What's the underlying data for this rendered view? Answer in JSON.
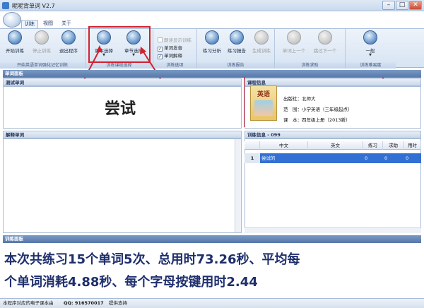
{
  "window": {
    "title": "呢呢背单词 V2.7",
    "min": "–",
    "max": "□",
    "close": "✕"
  },
  "tabs": [
    "训练",
    "视图",
    "关于"
  ],
  "ribbon": {
    "group1": {
      "caption": "开始英语单词强化记忆训练",
      "btn_start": "开始训练",
      "btn_stop": "停止训练",
      "btn_exit": "退出程序"
    },
    "group2": {
      "caption": "训练课程选择",
      "btn_textbook": "课本选择",
      "btn_chapter": "章节选择"
    },
    "group3": {
      "caption": "训练选项",
      "opt1": "朗读显示训练",
      "opt2": "单词发音",
      "opt3": "单词解释"
    },
    "group4": {
      "caption": "训练报告",
      "btn_analysis": "练习分析",
      "btn_report": "练习报告",
      "btn_generate": "生成训练"
    },
    "group5": {
      "caption": "训练求助",
      "btn_prev": "单词上一个",
      "btn_next": "跳过下一个"
    },
    "group6": {
      "caption": "训练难易度",
      "btn_level": "一般"
    }
  },
  "panels": {
    "word_panel": "单词面板",
    "test_word": "测试单词",
    "test_word_value": "尝试",
    "explain_word": "解释单词",
    "course_info": "课程信息",
    "train_info": "训练信息 - 099",
    "train_panel": "训练面板"
  },
  "course": {
    "book_title": "英语",
    "publisher": "出版社：北师大",
    "scope": "范　围：小学英语（三年级起点）",
    "volume": "课　本：四年级上册（2013新）"
  },
  "table": {
    "headers": [
      "",
      "中文",
      "英文",
      "练习",
      "求助",
      "用时"
    ],
    "rows": [
      [
        "1",
        "尝试的",
        "",
        "0",
        "0",
        "0"
      ]
    ]
  },
  "summary": {
    "line1": "本次共练习15个单词5次、总用时73.26秒、平均每",
    "line2": "个单词消耗4.88秒、每个字母按键用时2.44"
  },
  "statusbar": {
    "left": "本程序对应的电子课本由",
    "qq": "QQ: 916570017",
    "right": "提供支持"
  },
  "colors": {
    "accent": "#3d6ca6",
    "annotation": "#d2212f",
    "selection": "#3370d4"
  }
}
